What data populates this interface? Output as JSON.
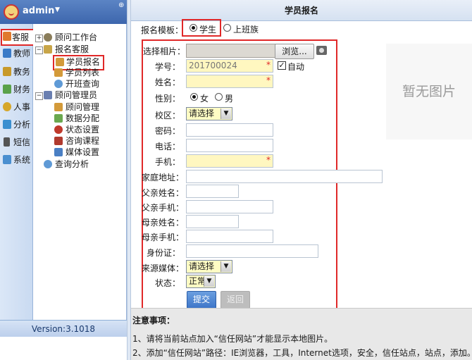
{
  "app": {
    "username": "admin",
    "version": "Version:3.1018"
  },
  "modules": [
    {
      "label": "客服",
      "color": "#e07a2f"
    },
    {
      "label": "教师",
      "color": "#3a7bc8"
    },
    {
      "label": "教务",
      "color": "#c89a2a"
    },
    {
      "label": "财务",
      "color": "#5aa24a"
    },
    {
      "label": "人事",
      "color": "#d6a72a"
    },
    {
      "label": "分析",
      "color": "#3a8fd0"
    },
    {
      "label": "短信",
      "color": "#555555"
    },
    {
      "label": "系统",
      "color": "#4a8fd0"
    }
  ],
  "tree": {
    "workbench": "顾问工作台",
    "enroll_group": "报名客服",
    "enroll": "学员报名",
    "student_list": "学员列表",
    "class_query": "开班查询",
    "advisor_admin": "顾问管理员",
    "advisor_mgmt": "顾问管理",
    "data_assign": "数据分配",
    "status_set": "状态设置",
    "course": "咨询课程",
    "media_set": "媒体设置",
    "query_analysis": "查询分析"
  },
  "page": {
    "title": "学员报名"
  },
  "template": {
    "label": "报名模板：",
    "option_student": "学生",
    "option_worker": "上班族",
    "selected": "学生"
  },
  "form": {
    "photo_label": "选择相片：",
    "browse": "浏览...",
    "student_id_label": "学号：",
    "student_id": "201700024",
    "auto_label": "自动",
    "auto_checked": true,
    "name_label": "姓名：",
    "gender_label": "性别：",
    "female": "女",
    "male": "男",
    "gender_selected": "女",
    "campus_label": "校区：",
    "campus_value": "请选择",
    "password_label": "密码：",
    "phone_label": "电话：",
    "mobile_label": "手机：",
    "address_label": "家庭地址：",
    "father_name_label": "父亲姓名：",
    "father_mobile_label": "父亲手机：",
    "mother_name_label": "母亲姓名：",
    "mother_mobile_label": "母亲手机：",
    "id_card_label": "身份证：",
    "media_label": "来源媒体：",
    "media_value": "请选择",
    "status_label": "状态：",
    "status_value": "正常",
    "required_mark": "*",
    "submit": "提交",
    "back": "返回"
  },
  "photo": {
    "placeholder": "暂无图片"
  },
  "notes": {
    "title": "注意事项：",
    "line1": "1、请将当前站点加入“信任网站”才能显示本地图片。",
    "line2": "2、添加“信任网站”路径：IE浏览器，工具，Internet选项，安全，信任站点，站点，添加。"
  }
}
